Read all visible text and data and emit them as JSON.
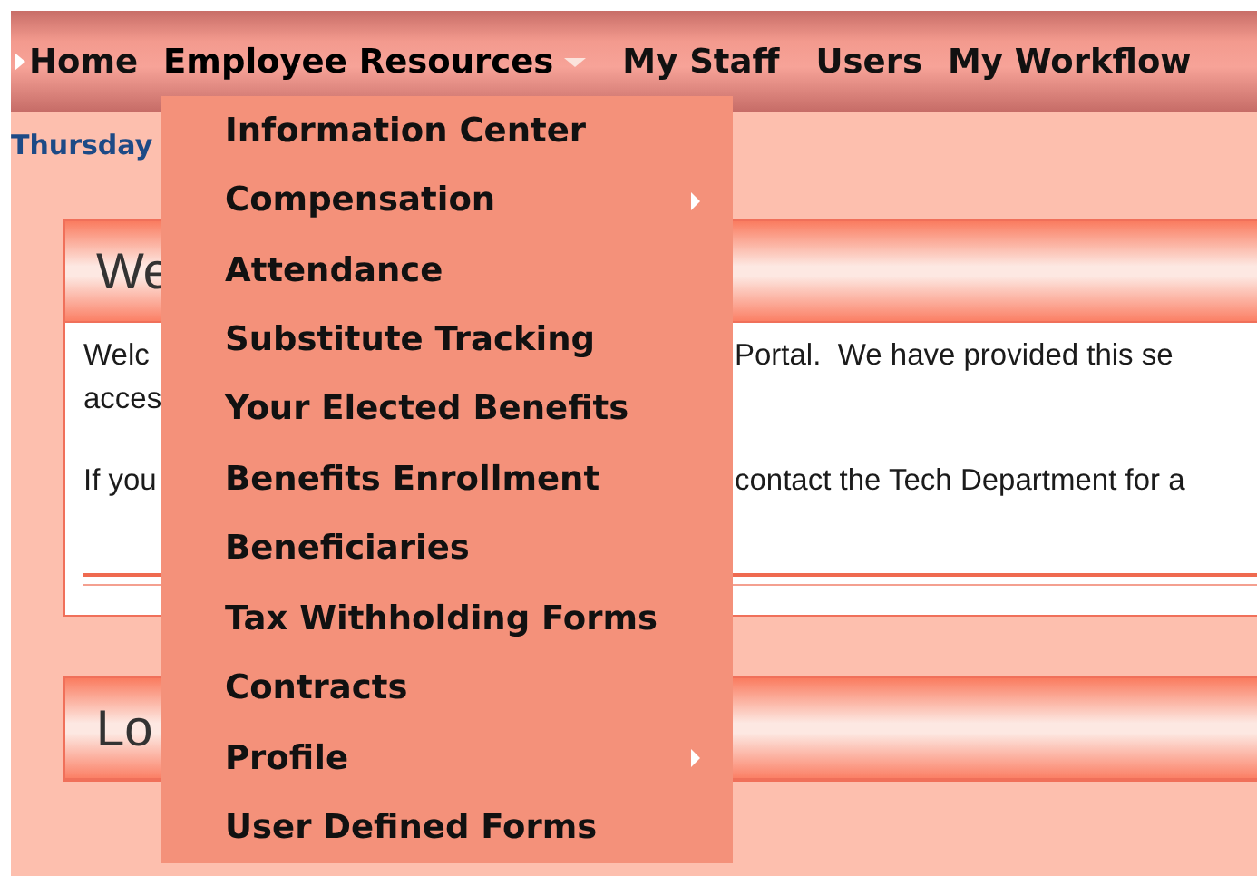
{
  "nav": {
    "items": [
      {
        "label": "Home",
        "pointer": true,
        "has_dropdown": false,
        "open": false
      },
      {
        "label": "Employee Resources",
        "pointer": false,
        "has_dropdown": true,
        "open": true
      },
      {
        "label": "My Staff",
        "pointer": false,
        "has_dropdown": false,
        "open": false
      },
      {
        "label": "Users",
        "pointer": false,
        "has_dropdown": false,
        "open": false
      },
      {
        "label": "My Workflow",
        "pointer": false,
        "has_dropdown": false,
        "open": false
      }
    ]
  },
  "date": "Thursday",
  "menu": {
    "items": [
      {
        "label": "Information Center",
        "submenu": false
      },
      {
        "label": "Compensation",
        "submenu": true
      },
      {
        "label": "Attendance",
        "submenu": false
      },
      {
        "label": "Substitute Tracking",
        "submenu": false
      },
      {
        "label": "Your Elected Benefits",
        "submenu": false
      },
      {
        "label": "Benefits Enrollment",
        "submenu": false
      },
      {
        "label": "Beneficiaries",
        "submenu": false
      },
      {
        "label": "Tax Withholding Forms",
        "submenu": false
      },
      {
        "label": "Contracts",
        "submenu": false
      },
      {
        "label": "Profile",
        "submenu": true
      },
      {
        "label": "User Defined Forms",
        "submenu": false
      }
    ]
  },
  "cards": [
    {
      "title": "We",
      "lines": [
        {
          "left": "Welc",
          "right": "Portal.  We have provided this se"
        },
        {
          "left": "acces"
        },
        {
          "left": "If you",
          "right": "contact the Tech Department for a"
        }
      ],
      "rule": true
    },
    {
      "title": "Lo",
      "rule": false
    }
  ]
}
